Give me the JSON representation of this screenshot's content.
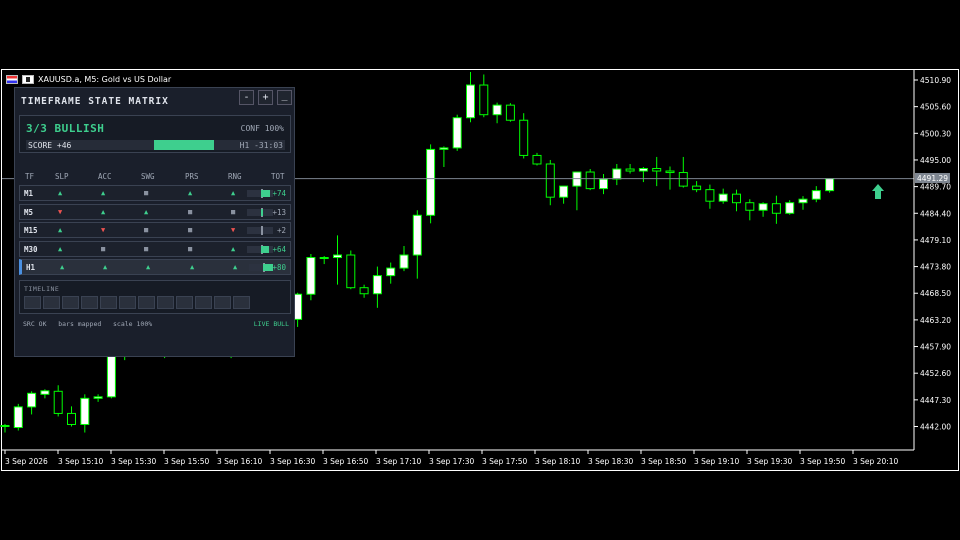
{
  "window": {
    "title": "XAUUSD.a, M5:  Gold vs US Dollar"
  },
  "chart_data": {
    "type": "candlestick",
    "ylim": [
      4439.0,
      4512.5
    ],
    "y_ticks": [
      "4510.90",
      "4505.60",
      "4500.30",
      "4495.00",
      "4489.70",
      "4484.40",
      "4479.10",
      "4473.80",
      "4468.50",
      "4463.20",
      "4457.90",
      "4452.60",
      "4447.30",
      "4442.00"
    ],
    "x_ticks": [
      "3 Sep 2026",
      "3 Sep 15:10",
      "3 Sep 15:30",
      "3 Sep 15:50",
      "3 Sep 16:10",
      "3 Sep 16:30",
      "3 Sep 16:50",
      "3 Sep 17:10",
      "3 Sep 17:30",
      "3 Sep 17:50",
      "3 Sep 18:10",
      "3 Sep 18:30",
      "3 Sep 18:50",
      "3 Sep 19:10",
      "3 Sep 19:30",
      "3 Sep 19:50",
      "3 Sep 20:10"
    ],
    "current_price": "4491.29",
    "colors": {
      "bull_body": "#ffffff",
      "bear_body": "#000000",
      "wick": "#00ff00",
      "bid_line": "#7d8590"
    },
    "candles": [
      [
        4442.0,
        4442.5,
        4440.8,
        4442.2
      ],
      [
        4441.8,
        4446.5,
        4441.2,
        4445.9
      ],
      [
        4445.9,
        4449.0,
        4444.4,
        4448.6
      ],
      [
        4448.4,
        4449.4,
        4447.6,
        4449.1
      ],
      [
        4449.0,
        4450.2,
        4444.0,
        4444.6
      ],
      [
        4444.6,
        4446.0,
        4442.0,
        4442.4
      ],
      [
        4442.4,
        4448.4,
        4440.8,
        4447.6
      ],
      [
        4447.6,
        4448.4,
        4446.9,
        4447.9
      ],
      [
        4447.9,
        4458.6,
        4447.6,
        4456.4
      ],
      [
        4456.4,
        4459.7,
        4455.2,
        4458.6
      ],
      [
        4458.6,
        4467.1,
        4457.4,
        4466.1
      ],
      [
        4466.1,
        4471.2,
        4458.7,
        4459.4
      ],
      [
        4459.4,
        4461.8,
        4455.6,
        4460.7
      ],
      [
        4460.7,
        4462.0,
        4457.8,
        4459.4
      ],
      [
        4459.4,
        4459.7,
        4456.3,
        4458.0
      ],
      [
        4458.0,
        4465.4,
        4456.3,
        4464.9
      ],
      [
        4464.9,
        4469.3,
        4460.0,
        4462.1
      ],
      [
        4462.1,
        4463.8,
        4455.6,
        4456.4
      ],
      [
        4456.4,
        4462.3,
        4456.1,
        4461.8
      ],
      [
        4461.8,
        4467.1,
        4460.9,
        4466.6
      ],
      [
        4466.6,
        4469.0,
        4461.7,
        4462.1
      ],
      [
        4462.1,
        4463.6,
        4460.1,
        4463.3
      ],
      [
        4463.3,
        4468.6,
        4461.8,
        4468.3
      ],
      [
        4468.3,
        4476.3,
        4467.1,
        4475.6
      ],
      [
        4475.6,
        4475.9,
        4474.3,
        4475.6
      ],
      [
        4475.6,
        4480.0,
        4470.2,
        4476.1
      ],
      [
        4476.1,
        4477.0,
        4469.3,
        4469.6
      ],
      [
        4469.6,
        4470.2,
        4467.6,
        4468.4
      ],
      [
        4468.4,
        4473.8,
        4465.6,
        4472.0
      ],
      [
        4472.0,
        4474.6,
        4470.4,
        4473.5
      ],
      [
        4473.5,
        4477.9,
        4472.9,
        4476.1
      ],
      [
        4476.1,
        4485.0,
        4471.4,
        4484.0
      ],
      [
        4484.0,
        4498.1,
        4482.4,
        4497.1
      ],
      [
        4497.1,
        4497.7,
        4493.6,
        4497.4
      ],
      [
        4497.4,
        4504.0,
        4496.8,
        4503.4
      ],
      [
        4503.4,
        4512.5,
        4502.5,
        4509.9
      ],
      [
        4509.9,
        4512.0,
        4503.5,
        4504.0
      ],
      [
        4504.0,
        4506.4,
        4502.3,
        4505.9
      ],
      [
        4505.9,
        4506.3,
        4502.6,
        4502.9
      ],
      [
        4502.9,
        4504.3,
        4495.3,
        4495.9
      ],
      [
        4495.9,
        4496.4,
        4493.9,
        4494.2
      ],
      [
        4494.2,
        4495.0,
        4486.0,
        4487.6
      ],
      [
        4487.6,
        4489.3,
        4486.3,
        4489.8
      ],
      [
        4489.8,
        4492.6,
        4485.0,
        4492.6
      ],
      [
        4492.6,
        4493.2,
        4489.0,
        4489.3
      ],
      [
        4489.3,
        4492.2,
        4488.2,
        4491.2
      ],
      [
        4491.2,
        4494.2,
        4490.0,
        4493.2
      ],
      [
        4493.2,
        4494.2,
        4492.3,
        4492.8
      ],
      [
        4492.8,
        4493.6,
        4490.6,
        4493.3
      ],
      [
        4493.3,
        4495.6,
        4489.8,
        4492.8
      ],
      [
        4492.8,
        4493.7,
        4489.1,
        4492.5
      ],
      [
        4492.5,
        4495.6,
        4489.5,
        4489.8
      ],
      [
        4489.8,
        4490.8,
        4488.6,
        4489.1
      ],
      [
        4489.1,
        4490.1,
        4485.3,
        4486.8
      ],
      [
        4486.8,
        4489.3,
        4486.3,
        4488.2
      ],
      [
        4488.2,
        4489.1,
        4484.8,
        4486.5
      ],
      [
        4486.5,
        4487.2,
        4483.0,
        4485.0
      ],
      [
        4485.0,
        4486.6,
        4483.7,
        4486.3
      ],
      [
        4486.3,
        4487.9,
        4482.3,
        4484.4
      ],
      [
        4484.4,
        4487.0,
        4484.1,
        4486.5
      ],
      [
        4486.5,
        4487.8,
        4485.1,
        4487.2
      ],
      [
        4487.2,
        4489.8,
        4486.6,
        4488.9
      ],
      [
        4488.9,
        4491.4,
        4488.5,
        4491.3
      ]
    ]
  },
  "panel": {
    "title": "TIMEFRAME STATE MATRIX",
    "buttons": {
      "minus": "-",
      "plus": "+",
      "minimize": "_"
    },
    "state": "3/3 BULLISH",
    "confidence": "CONF 100%",
    "score_label": "SCORE +46",
    "score_fill": 0.23,
    "h1_timer": "H1 -31:03",
    "columns": [
      "TF",
      "SLP",
      "ACC",
      "SWG",
      "PRS",
      "RNG",
      "TOT"
    ],
    "rows": [
      {
        "tf": "M1",
        "cells": [
          "up",
          "up",
          "nt",
          "up",
          "up"
        ],
        "total": "+74",
        "tot_value": 74,
        "active": false
      },
      {
        "tf": "M5",
        "cells": [
          "dn",
          "up",
          "up",
          "nt",
          "nt"
        ],
        "total": "+13",
        "tot_value": 13,
        "active": false
      },
      {
        "tf": "M15",
        "cells": [
          "up",
          "dn",
          "nt",
          "nt",
          "dn"
        ],
        "total": "+2",
        "tot_value": 2,
        "active": false
      },
      {
        "tf": "M30",
        "cells": [
          "up",
          "nt",
          "nt",
          "nt",
          "up"
        ],
        "total": "+64",
        "tot_value": 64,
        "active": false
      },
      {
        "tf": "H1",
        "cells": [
          "up",
          "up",
          "up",
          "up",
          "up"
        ],
        "total": "+80",
        "tot_value": 80,
        "active": true
      }
    ],
    "symbols": {
      "up": "▲",
      "dn": "▼",
      "nt": "■"
    },
    "timeline_label": "TIMELINE",
    "timeline_cells": 12,
    "footer_status": "SRC OK   bars mapped   scale 100%",
    "footer_live": "LIVE BULL",
    "colors": {
      "bull": "#3ecf8e",
      "bear": "#ef5350",
      "neutral": "#8a92a0",
      "panel_bg": "#1a1f2b"
    }
  }
}
